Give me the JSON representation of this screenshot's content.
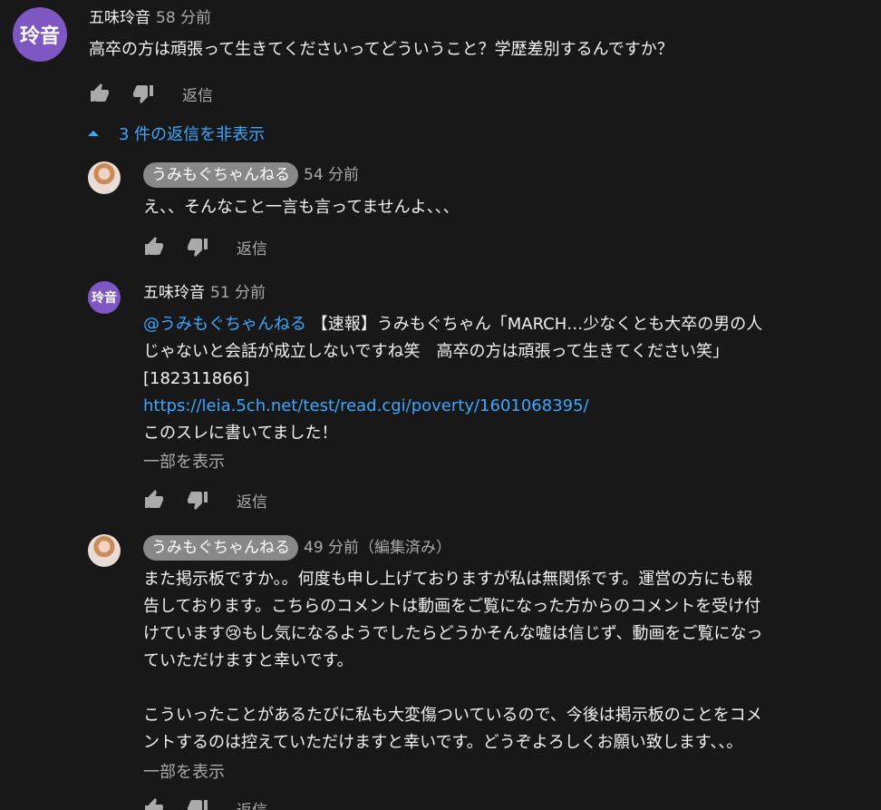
{
  "top_comment": {
    "avatar_text": "玲音",
    "author": "五味玲音",
    "time": "58 分前",
    "text": "高卒の方は頑張って生きてくださいってどういうこと？学歴差別するんですか？",
    "reply_label": "返信",
    "toggle_replies": "3 件の返信を非表示"
  },
  "replies": [
    {
      "author": "うみもぐちゃんねる",
      "time": "54 分前",
      "text": "え、、そんなこと一言も言ってませんよ、、、",
      "reply_label": "返信"
    },
    {
      "avatar_text": "玲音",
      "author": "五味玲音",
      "time": "51 分前",
      "mention": "@うみもぐちゃんねる",
      "text_part1": "【速報】うみもぐちゃん「MARCH…少なくとも大卒の男の人",
      "text_part2": "じゃないと会話が成立しないですね笑　高卒の方は頑張って生きてください笑」",
      "text_part3": "[182311866]",
      "link": "https://leia.5ch.net/test/read.cgi/poverty/1601068395/",
      "text_part4": "このスレに書いてました！",
      "show_more": "一部を表示",
      "reply_label": "返信"
    },
    {
      "author": "うみもぐちゃんねる",
      "time": "49 分前（編集済み）",
      "line1": "また掲示板ですか。。何度も申し上げておりますが私は無関係です。運営の方にも報",
      "line2": "告しております。こちらのコメントは動画をご覧になった方からのコメントを受け付",
      "line3a": "けています",
      "emoji": "😢",
      "line3b": "もし気になるようでしたらどうかそんな嘘は信じず、動画をご覧になっ",
      "line4": "ていただけますと幸いです。",
      "line5": "こういったことがあるたびに私も大変傷ついているので、今後は掲示板のことをコメ",
      "line6": "ントするのは控えていただけますと幸いです。どうぞよろしくお願い致します、、。",
      "show_more": "一部を表示",
      "reply_label": "返信"
    }
  ],
  "colors": {
    "background": "#181818",
    "link": "#3ea6ff",
    "secondary": "#aaaaaa",
    "avatar_purple": "#7e57c2"
  },
  "icons": [
    "thumb-up-icon",
    "thumb-down-icon",
    "chevron-up-icon"
  ]
}
